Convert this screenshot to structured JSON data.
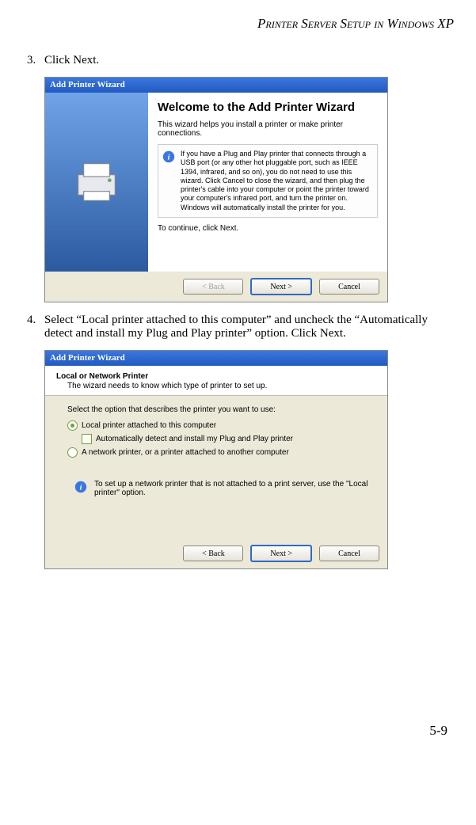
{
  "header": "Printer Server Setup in Windows XP",
  "steps": {
    "s3": {
      "num": "3.",
      "text": "Click Next."
    },
    "s4": {
      "num": "4.",
      "text": "Select “Local printer attached to this computer” and uncheck the “Automatically detect and install my Plug and Play printer” option. Click Next."
    }
  },
  "wiz1": {
    "title": "Add Printer Wizard",
    "heading": "Welcome to the Add Printer Wizard",
    "intro": "This wizard helps you install a printer or make printer connections.",
    "info": "If you have a Plug and Play printer that connects through a USB port (or any other hot pluggable port, such as IEEE 1394, infrared, and so on), you do not need to use this wizard. Click Cancel to close the wizard, and then plug the printer's cable into your computer or point the printer toward your computer's infrared port, and turn the printer on. Windows will automatically install the printer for you.",
    "continue": "To continue, click Next.",
    "back": "< Back",
    "next": "Next >",
    "cancel": "Cancel"
  },
  "wiz2": {
    "title": "Add Printer Wizard",
    "h_title": "Local or Network Printer",
    "h_sub": "The wizard needs to know which type of printer to set up.",
    "select_label": "Select the option that describes the printer you want to use:",
    "opt1": "Local printer attached to this computer",
    "opt1_check": "Automatically detect and install my Plug and Play printer",
    "opt2": "A network printer, or a printer attached to another computer",
    "tip": "To set up a network printer that is not attached to a print server, use the \"Local printer\" option.",
    "back": "< Back",
    "next": "Next >",
    "cancel": "Cancel"
  },
  "page_num": "5-9"
}
